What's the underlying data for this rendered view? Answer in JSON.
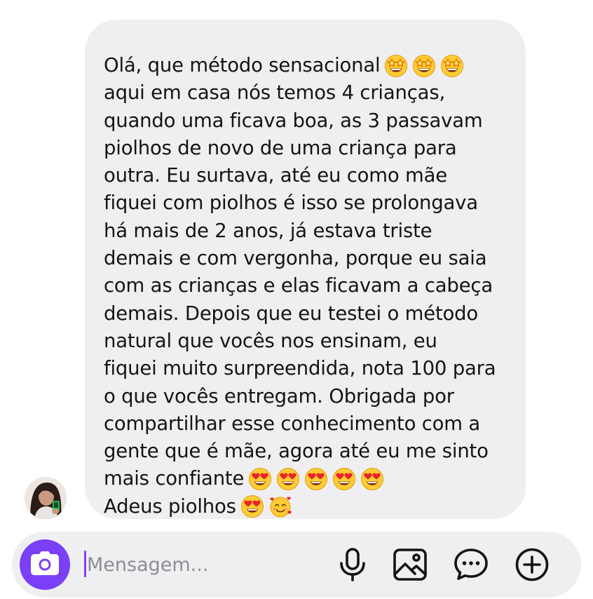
{
  "message": {
    "lines": [
      {
        "text": "Olá, que método sensacional",
        "emojis": [
          "star-struck",
          "star-struck",
          "star-struck"
        ]
      },
      {
        "text": "aqui em casa nós temos 4 crianças,",
        "emojis": []
      },
      {
        "text": "quando uma ficava boa, as 3 passavam",
        "emojis": []
      },
      {
        "text": "piolhos de novo de uma criança para",
        "emojis": []
      },
      {
        "text": "outra. Eu surtava, até eu como mãe",
        "emojis": []
      },
      {
        "text": "fiquei com piolhos é isso se prolongava",
        "emojis": []
      },
      {
        "text": "há mais de 2 anos, já estava triste",
        "emojis": []
      },
      {
        "text": "demais e com vergonha, porque eu saia",
        "emojis": []
      },
      {
        "text": "com as crianças e elas ficavam a cabeça",
        "emojis": []
      },
      {
        "text": "demais. Depois que eu testei o método",
        "emojis": []
      },
      {
        "text": "natural que vocês nos ensinam, eu",
        "emojis": []
      },
      {
        "text": "fiquei muito surpreendida, nota 100 para",
        "emojis": []
      },
      {
        "text": "o que vocês entregam. Obrigada por",
        "emojis": []
      },
      {
        "text": "compartilhar esse conhecimento com a",
        "emojis": []
      },
      {
        "text": "gente que é mãe, agora até eu me sinto",
        "emojis": []
      },
      {
        "text": "mais confiante",
        "emojis": [
          "heart-eyes",
          "heart-eyes",
          "heart-eyes",
          "heart-eyes",
          "heart-eyes"
        ]
      },
      {
        "text": "Adeus piolhos",
        "emojis": [
          "heart-eyes",
          "smiling-face-with-hearts"
        ]
      }
    ]
  },
  "composer": {
    "placeholder": "Mensagem...",
    "value": ""
  },
  "icons": {
    "camera": "camera-icon",
    "microphone": "microphone-icon",
    "gallery": "image-icon",
    "sticker": "chat-bubble-icon",
    "add": "plus-circle-icon"
  },
  "colors": {
    "accent": "#7a3ff7",
    "bubble": "#efeff1",
    "text": "#141414",
    "placeholder": "#8e8e93"
  }
}
